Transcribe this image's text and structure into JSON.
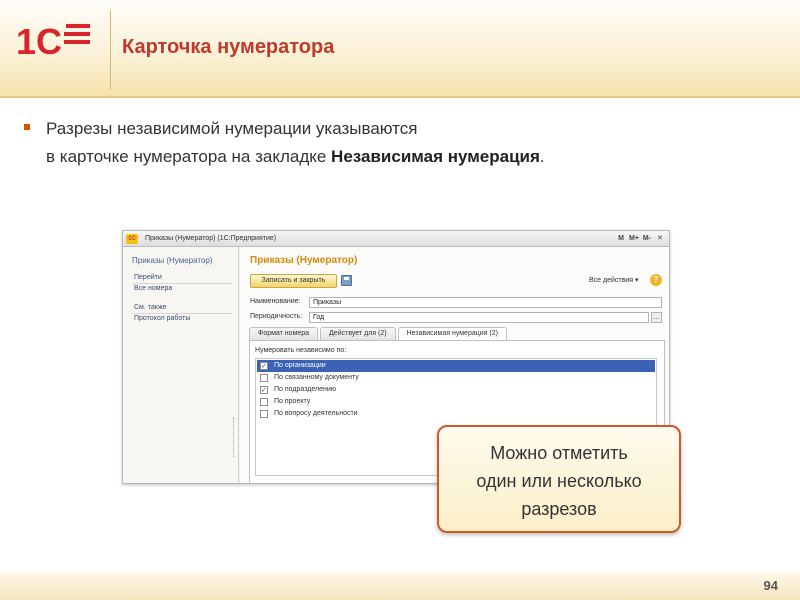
{
  "header": {
    "logo_text": "1С",
    "title": "Карточка нумератора"
  },
  "body": {
    "line1": "Разрезы независимой нумерации указываются",
    "line2_prefix": "в карточке нумератора на закладке ",
    "line2_bold": "Независимая нумерация",
    "line2_suffix": "."
  },
  "window": {
    "title": "Приказы (Нумератор)  (1С:Предприятие)",
    "title_buttons": [
      "M",
      "M+",
      "M-",
      "✕"
    ],
    "sidebar": {
      "title": "Приказы (Нумератор)",
      "section1": "Перейти",
      "link_all_numbers": "Все номера",
      "section2": "См. также",
      "link_protocol": "Протокол работы"
    },
    "form": {
      "title": "Приказы (Нумератор)",
      "save_close_label": "Записать и закрыть",
      "all_actions_label": "Все действия ▾",
      "help_label": "?",
      "name_label": "Наименование:",
      "name_value": "Приказы",
      "period_label": "Периодичность:",
      "period_value": "Год",
      "period_btn": "…",
      "tabs": [
        {
          "label": "Формат номера"
        },
        {
          "label": "Действует для (2)"
        },
        {
          "label": "Независимая нумерация (2)"
        }
      ],
      "panel_caption": "Нумеровать независимо по:",
      "options": [
        {
          "label": "По организации",
          "checked": true,
          "mark": "✓"
        },
        {
          "label": "По связанному документу",
          "checked": false,
          "mark": ""
        },
        {
          "label": "По подразделению",
          "checked": true,
          "mark": "✓"
        },
        {
          "label": "По проекту",
          "checked": false,
          "mark": ""
        },
        {
          "label": "По вопросу деятельности",
          "checked": false,
          "mark": ""
        }
      ]
    }
  },
  "callout": {
    "line1": "Можно отметить",
    "line2": "один или несколько",
    "line3": "разрезов"
  },
  "footer": {
    "page_number": "94"
  },
  "colors": {
    "title_red": "#c0392b",
    "accent_orange": "#d4562b",
    "selection_blue": "#3b62b5"
  }
}
